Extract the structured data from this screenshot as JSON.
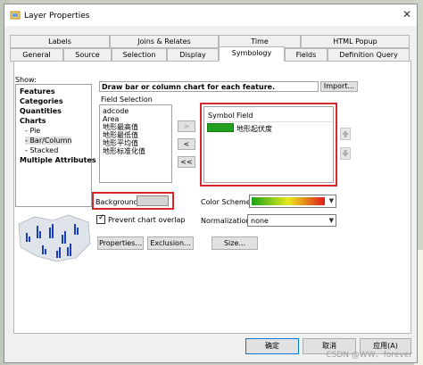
{
  "window": {
    "title": "Layer Properties"
  },
  "tabs_row1": [
    "Labels",
    "Joins & Relates",
    "Time",
    "HTML Popup"
  ],
  "tabs_row2": [
    "General",
    "Source",
    "Selection",
    "Display",
    "Symbology",
    "Fields",
    "Definition Query"
  ],
  "show": {
    "label": "Show:",
    "items": [
      "Features",
      "Categories",
      "Quantities",
      "Charts",
      "Pie",
      "Bar/Column",
      "Stacked",
      "Multiple Attributes"
    ]
  },
  "header": {
    "description": "Draw bar or column chart for each feature.",
    "import_label": "Import..."
  },
  "field_selection": {
    "label": "Field Selection",
    "items": [
      "adcode",
      "Area",
      "地形最高值",
      "地形最低值",
      "地形平均值",
      "地形标准化值"
    ]
  },
  "move_buttons": {
    "add": ">",
    "remove": "<",
    "remove_all": "<<"
  },
  "symbol_table": {
    "col_symbol": "Symbol",
    "col_field": "Field",
    "rows": [
      {
        "color": "#21a01e",
        "field": "地形起伏度"
      }
    ]
  },
  "background": {
    "label": "Background:",
    "color": "#d4d4d4"
  },
  "color_scheme": {
    "label": "Color  Scheme:"
  },
  "prevent_overlap": {
    "label": "Prevent chart overlap",
    "checked": true
  },
  "normalization": {
    "label": "Normalization:",
    "value": "none"
  },
  "buttons": {
    "properties": "Properties...",
    "exclusion": "Exclusion...",
    "size": "Size..."
  },
  "dialog": {
    "ok": "确定",
    "cancel": "取消",
    "apply": "应用(A)"
  },
  "watermark": "CSDN @WW、forever"
}
